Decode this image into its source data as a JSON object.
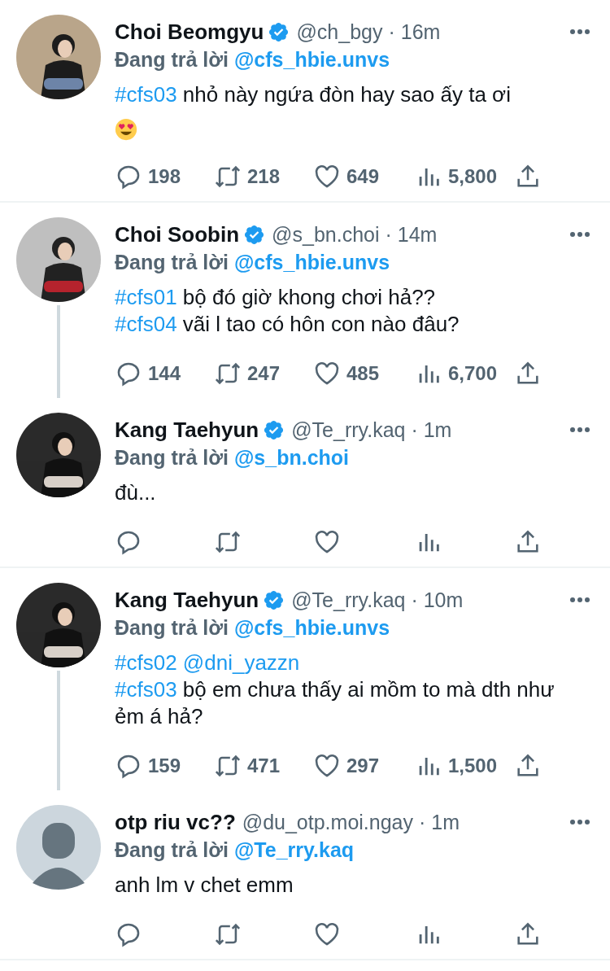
{
  "tweets": [
    {
      "name": "Choi Beomgyu",
      "verified": true,
      "handle": "@ch_bgy",
      "time": "· 16m",
      "avatar": {
        "kind": "picture"
      },
      "reply_label": "Đang trả lời",
      "reply_to": "@cfs_hbie.unvs",
      "thread": false,
      "body": [
        [
          {
            "kind": "hashtag",
            "text": "#cfs03"
          },
          {
            "kind": "text",
            "text": "nhỏ này ngứa đòn hay sao ấy ta ơi"
          }
        ]
      ],
      "emoji": {
        "kind": "heart_eyes"
      },
      "stats": [
        {
          "kind": "reply",
          "count": "198"
        },
        {
          "kind": "retweet",
          "count": "218"
        },
        {
          "kind": "like",
          "count": "649"
        },
        {
          "kind": "views",
          "count": "5,800"
        },
        {
          "kind": "share"
        }
      ]
    },
    {
      "name": "Choi Soobin",
      "verified": true,
      "handle": "@s_bn.choi",
      "time": "· 14m",
      "avatar": {
        "kind": "picture"
      },
      "reply_label": "Đang trả lời",
      "reply_to": "@cfs_hbie.unvs",
      "thread": true,
      "body": [
        [
          {
            "kind": "hashtag",
            "text": "#cfs01"
          },
          {
            "kind": "text",
            "text": "bộ đó giờ khong chơi hả??"
          }
        ],
        [
          {
            "kind": "hashtag",
            "text": "#cfs04"
          },
          {
            "kind": "text",
            "text": "vãi l tao có hôn con nào đâu?"
          }
        ]
      ],
      "stats": [
        {
          "kind": "reply",
          "count": "144"
        },
        {
          "kind": "retweet",
          "count": "247"
        },
        {
          "kind": "like",
          "count": "485"
        },
        {
          "kind": "views",
          "count": "6,700"
        },
        {
          "kind": "share"
        }
      ]
    },
    {
      "name": "Kang Taehyun",
      "verified": true,
      "handle": "@Te_rry.kaq",
      "time": "· 1m",
      "avatar": {
        "kind": "picture"
      },
      "reply_label": "Đang trả lời",
      "reply_to": "@s_bn.choi",
      "thread": false,
      "body": [
        [
          {
            "kind": "text",
            "text": "đù..."
          }
        ]
      ],
      "stats": [
        {
          "kind": "reply"
        },
        {
          "kind": "retweet"
        },
        {
          "kind": "like"
        },
        {
          "kind": "views"
        },
        {
          "kind": "share"
        }
      ]
    },
    {
      "name": "Kang Taehyun",
      "verified": true,
      "handle": "@Te_rry.kaq",
      "time": "· 10m",
      "avatar": {
        "kind": "picture"
      },
      "reply_label": "Đang trả lời",
      "reply_to": "@cfs_hbie.unvs",
      "thread": true,
      "body": [
        [
          {
            "kind": "hashtag",
            "text": "#cfs02"
          },
          {
            "kind": "mention",
            "text": "@dni_yazzn"
          }
        ],
        [
          {
            "kind": "hashtag",
            "text": "#cfs03"
          },
          {
            "kind": "text",
            "text": "bộ em chưa thấy ai mồm to mà dth như ẻm á hả?"
          }
        ]
      ],
      "stats": [
        {
          "kind": "reply",
          "count": "159"
        },
        {
          "kind": "retweet",
          "count": "471"
        },
        {
          "kind": "like",
          "count": "297"
        },
        {
          "kind": "views",
          "count": "1,500"
        },
        {
          "kind": "share"
        }
      ]
    },
    {
      "name": "otp riu vc??",
      "verified": false,
      "handle": "@du_otp.moi.ngay",
      "time": "· 1m",
      "avatar": {
        "kind": "silhouette"
      },
      "reply_label": "Đang trả lời",
      "reply_to": "@Te_rry.kaq",
      "thread": false,
      "body": [
        [
          {
            "kind": "text",
            "text": "anh lm v chet emm"
          }
        ]
      ],
      "stats": [
        {
          "kind": "reply"
        },
        {
          "kind": "retweet"
        },
        {
          "kind": "like"
        },
        {
          "kind": "views"
        },
        {
          "kind": "share"
        }
      ]
    }
  ]
}
